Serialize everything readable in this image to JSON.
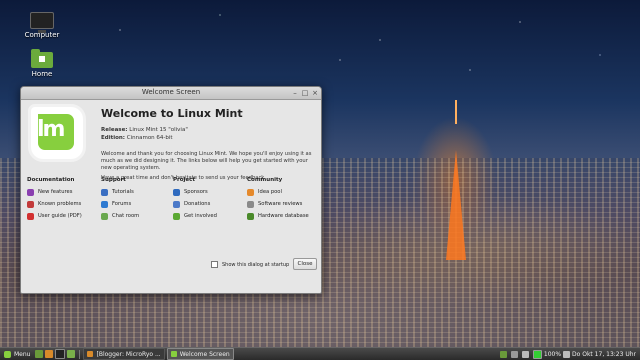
{
  "desktop": {
    "icons": [
      {
        "label": "Computer",
        "icon": "computer-icon"
      },
      {
        "label": "Home",
        "icon": "home-folder-icon"
      }
    ]
  },
  "window": {
    "title": "Welcome Screen",
    "heading": "Welcome to Linux Mint",
    "release_label": "Release:",
    "release_value": "Linux Mint 15 \"olivia\"",
    "edition_label": "Edition:",
    "edition_value": "Cinnamon 64-bit",
    "intro_1": "Welcome and thank you for choosing Linux Mint. We hope you'll enjoy using it as much as we did designing it. The links below will help you get started with your new operating system.",
    "intro_2": "Have a great time and don't hesitate to send us your feedback.",
    "columns": [
      {
        "title": "Documentation",
        "links": [
          {
            "label": "New features",
            "icon": "new-features-icon",
            "color": "#8a3fb0"
          },
          {
            "label": "Known problems",
            "icon": "known-problems-icon",
            "color": "#c23a3a"
          },
          {
            "label": "User guide (PDF)",
            "icon": "pdf-icon",
            "color": "#d23030"
          }
        ]
      },
      {
        "title": "Support",
        "links": [
          {
            "label": "Tutorials",
            "icon": "tutorials-icon",
            "color": "#3a6fc2"
          },
          {
            "label": "Forums",
            "icon": "forums-icon",
            "color": "#2e7ad1"
          },
          {
            "label": "Chat room",
            "icon": "chat-room-icon",
            "color": "#6aa84f"
          }
        ]
      },
      {
        "title": "Project",
        "links": [
          {
            "label": "Sponsors",
            "icon": "sponsors-icon",
            "color": "#2f6bbf"
          },
          {
            "label": "Donations",
            "icon": "donations-icon",
            "color": "#4b79c8"
          },
          {
            "label": "Get involved",
            "icon": "get-involved-icon",
            "color": "#5aa832"
          }
        ]
      },
      {
        "title": "Community",
        "links": [
          {
            "label": "Idea pool",
            "icon": "idea-pool-icon",
            "color": "#e5892b"
          },
          {
            "label": "Software reviews",
            "icon": "software-reviews-icon",
            "color": "#8a8a8a"
          },
          {
            "label": "Hardware database",
            "icon": "hardware-database-icon",
            "color": "#4a8a2a"
          }
        ]
      }
    ],
    "startup_checkbox_label": "Show this dialog at startup",
    "startup_checked": false,
    "close_label": "Close"
  },
  "taskbar": {
    "menu_label": "Menu",
    "tasks": [
      {
        "label": "[Blogger: MicroRyo ...",
        "active": false
      },
      {
        "label": "Welcome Screen",
        "active": true
      }
    ],
    "battery": "100%",
    "clock": "Do Okt 17, 13:23 Uhr"
  }
}
